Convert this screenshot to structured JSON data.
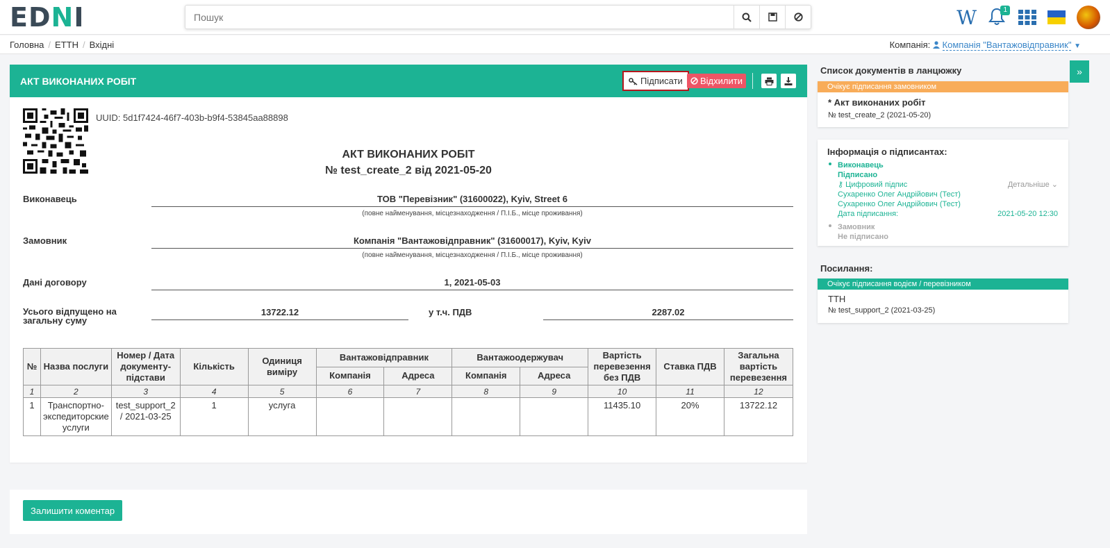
{
  "header": {
    "logo_main": "ED",
    "logo_accent": "N",
    "logo_end": "I",
    "search_placeholder": "Пошук",
    "notification_count": "1",
    "w_label": "W"
  },
  "breadcrumb": [
    "Головна",
    "ЕТТН",
    "Вхідні"
  ],
  "company": {
    "label": "Компанія:",
    "name": "Компанія \"Вантажовідправник\""
  },
  "panel": {
    "title": "АКТ ВИКОНАНИХ РОБІТ",
    "sign_label": "Підписати",
    "reject_label": "Відхилити"
  },
  "document": {
    "uuid": "UUID: 5d1f7424-46f7-403b-b9f4-53845aa88898",
    "title": "АКТ ВИКОНАНИХ РОБІТ",
    "subtitle": "№ test_create_2 від 2021-05-20",
    "executor_label": "Виконавець",
    "executor_value": "ТОВ \"Перевізник\" (31600022), Kyiv, Street 6",
    "customer_label": "Замовник",
    "customer_value": "Компанія \"Вантажовідправник\" (31600017), Kyiv, Kyiv",
    "hint": "(повне найменування, місцезнаходження / П.І.Б., місце проживання)",
    "contract_label": "Дані договору",
    "contract_value": "1, 2021-05-03",
    "total_label": "Усього відпущено на загальну суму",
    "total_value": "13722.12",
    "vat_label": "у т.ч. ПДВ",
    "vat_value": "2287.02"
  },
  "table": {
    "h_no": "№",
    "h_service": "Назва послуги",
    "h_docnum": "Номер / Дата документу-підстави",
    "h_qty": "Кількість",
    "h_unit": "Одиниця виміру",
    "h_shipper": "Вантажовідправник",
    "h_consignee": "Вантажоодержувач",
    "h_company": "Компанія",
    "h_address": "Адреса",
    "h_cost": "Вартість перевезення без ПДВ",
    "h_vat": "Ставка ПДВ",
    "h_total": "Загальна вартість перевезення",
    "nums": [
      "1",
      "2",
      "3",
      "4",
      "5",
      "6",
      "7",
      "8",
      "9",
      "10",
      "11",
      "12"
    ],
    "row": {
      "no": "1",
      "service": "Транспортно-экспедиторские услуги",
      "docnum": "test_support_2 / 2021-03-25",
      "qty": "1",
      "unit": "услуга",
      "shipper_company": "",
      "shipper_address": "",
      "consignee_company": "",
      "consignee_address": "",
      "cost": "11435.10",
      "vat": "20%",
      "total": "13722.12"
    }
  },
  "comment_button": "Залишити коментар",
  "sidebar": {
    "chain_title": "Список документів в ланцюжку",
    "chain_status": "Очікує підписання замовником",
    "chain_doc_title": "* Акт виконаних робіт",
    "chain_doc_num": "№ test_create_2 (2021-05-20)",
    "signers_title": "Інформація о підписантах:",
    "signer1_role": "Виконавець",
    "signer1_status": "Підписано",
    "signer1_sig": "Цифровий підпис",
    "signer1_details": "Детальніше",
    "signer1_name1": "Сухаренко Олег Андрійович (Тест)",
    "signer1_name2": "Сухаренко Олег Андрійович (Тест)",
    "signer1_date_label": "Дата підписання:",
    "signer1_date": "2021-05-20 12:30",
    "signer2_role": "Замовник",
    "signer2_status": "Не підписано",
    "links_title": "Посилання:",
    "link_status": "Очікує підписання водієм / перевізником",
    "link_doc_title": "ТТН",
    "link_doc_num": "№ test_support_2 (2021-03-25)"
  },
  "colors": {
    "accent": "#1cb394",
    "danger": "#ed5565",
    "warning": "#f8ac59",
    "dark": "#3a4a57"
  }
}
